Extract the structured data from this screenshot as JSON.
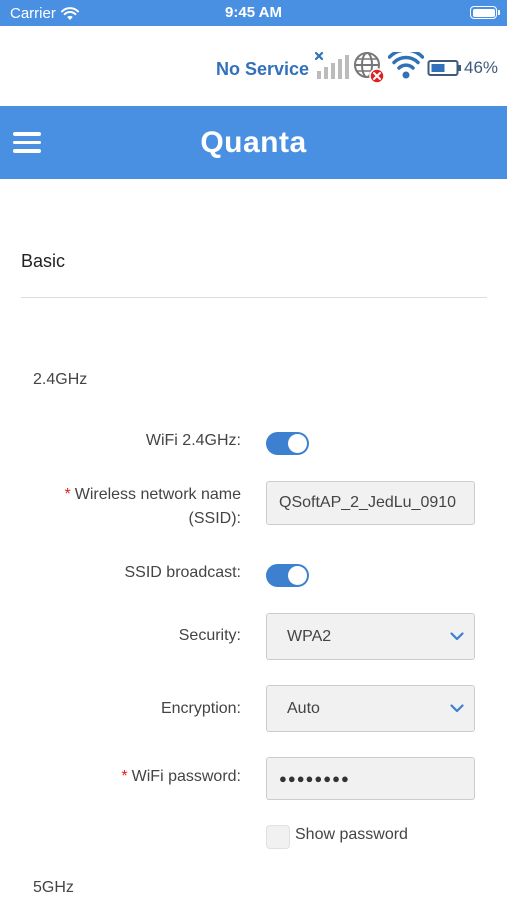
{
  "ios_status": {
    "carrier": "Carrier",
    "time": "9:45 AM"
  },
  "router_status": {
    "service": "No Service",
    "battery_percent": "46%",
    "cellular_signal": "no-signal",
    "internet": "disconnected"
  },
  "header": {
    "title": "Quanta"
  },
  "section": {
    "title": "Basic"
  },
  "band_24": {
    "title": "2.4GHz",
    "wifi_label": "WiFi 2.4GHz:",
    "wifi_enabled": true,
    "ssid_label_line1": "Wireless network name",
    "ssid_label_line2": "(SSID):",
    "ssid_value": "QSoftAP_2_JedLu_0910",
    "broadcast_label": "SSID broadcast:",
    "broadcast_enabled": true,
    "security_label": "Security:",
    "security_value": "WPA2",
    "encryption_label": "Encryption:",
    "encryption_value": "Auto",
    "password_label": "WiFi password:",
    "password_masked": "●●●●●●●●",
    "show_password_label": "Show password",
    "show_password_checked": false
  },
  "band_5": {
    "title": "5GHz"
  },
  "colors": {
    "accent": "#4a90e2",
    "toggle": "#3d80d0",
    "required": "#e02020",
    "service_text": "#3071b9"
  },
  "icons": [
    "wifi-icon",
    "signal-icon",
    "globe-icon",
    "battery-icon",
    "menu-icon",
    "chevron-down-icon"
  ]
}
